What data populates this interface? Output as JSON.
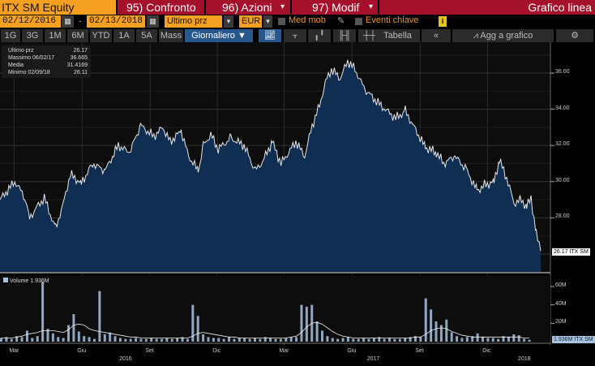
{
  "header": {
    "ticker": "ITX SM Equity",
    "compare": "95) Confronto",
    "actions": "96) Azioni",
    "modify": "97) Modif",
    "chart_type": "Grafico linea"
  },
  "controls": {
    "start_date": "02/12/2016",
    "dash": "-",
    "end_date": "02/13/2018",
    "field": "Ultimo prz",
    "currency": "EUR",
    "moving_avg": "Med mob",
    "key_events": "Eventi chiave",
    "info": "i"
  },
  "toolbar": {
    "periods": [
      "1G",
      "3G",
      "1M",
      "6M",
      "YTD",
      "1A",
      "5A",
      "Mass"
    ],
    "frequency": "Giornaliero ▼",
    "table": "Tabella",
    "collapse": "«",
    "add_to_chart": "Agg a grafico",
    "settings": "⚙"
  },
  "legend": [
    {
      "label": "Ultimo prz",
      "value": "26.17"
    },
    {
      "label": "Massimo 06/02/17",
      "value": "36.665"
    },
    {
      "label": "Media",
      "value": "31.4169"
    },
    {
      "label": "Minimo 02/09/18",
      "value": "26.11"
    }
  ],
  "volume_legend": "Volume 1.936M",
  "last_price_tag": "26.17 ITX SM",
  "last_volume_tag": "1.936M ITX SM",
  "colors": {
    "orange": "#f5a020",
    "red": "#a5102a",
    "area": "#0f2e52",
    "line": "#e6e6e6",
    "volume": "#a7c3e0"
  },
  "chart_data": [
    {
      "type": "area",
      "title": "ITX SM Equity - Ultimo prz",
      "x_unit": "days since 02/12/2016",
      "ylim": [
        25.5,
        37.5
      ],
      "yticks": [
        "36.00",
        "34.00",
        "32.00",
        "30.00",
        "28.00"
      ],
      "xticks": [
        {
          "label": "Mar",
          "day": 19
        },
        {
          "label": "Giu",
          "day": 111
        },
        {
          "label": "Set",
          "day": 203
        },
        {
          "label": "Dic",
          "day": 294
        },
        {
          "label": "Mar",
          "day": 384
        },
        {
          "label": "Giu",
          "day": 476
        },
        {
          "label": "Set",
          "day": 568
        },
        {
          "label": "Dic",
          "day": 659
        }
      ],
      "years": [
        {
          "label": "2016",
          "day": 170
        },
        {
          "label": "2017",
          "day": 505
        },
        {
          "label": "2018",
          "day": 709
        }
      ],
      "x": [
        0,
        8,
        20,
        33,
        40,
        50,
        60,
        75,
        85,
        95,
        110,
        125,
        142,
        160,
        175,
        190,
        208,
        220,
        230,
        245,
        255,
        268,
        275,
        285,
        295,
        312,
        330,
        345,
        355,
        368,
        380,
        390,
        400,
        412,
        422,
        432,
        440,
        448,
        460,
        470,
        480,
        493,
        515,
        535,
        548,
        560,
        575,
        590,
        600,
        615,
        630,
        645,
        655,
        668,
        675,
        685,
        695,
        705,
        712,
        718,
        725,
        731
      ],
      "y": [
        29.0,
        29.4,
        30.0,
        29.2,
        28.0,
        28.6,
        29.1,
        27.4,
        28.7,
        30.4,
        29.9,
        31.0,
        30.6,
        32.0,
        31.6,
        33.1,
        32.5,
        33.0,
        32.2,
        32.8,
        31.4,
        30.6,
        32.0,
        32.6,
        31.8,
        32.4,
        32.0,
        30.6,
        31.1,
        32.2,
        31.0,
        31.6,
        32.2,
        31.4,
        33.1,
        34.2,
        35.5,
        36.2,
        35.7,
        36.665,
        36.2,
        35.1,
        34.2,
        33.5,
        33.9,
        33.0,
        31.9,
        31.6,
        31.0,
        31.4,
        30.7,
        29.5,
        29.8,
        30.0,
        31.2,
        30.2,
        28.8,
        29.0,
        28.6,
        29.1,
        27.1,
        26.17
      ]
    },
    {
      "type": "bar",
      "title": "Volume",
      "ylim": [
        0,
        75
      ],
      "yticks": [
        "60M",
        "40M",
        "20M"
      ],
      "unit": "M",
      "x_step_days": 7,
      "values": [
        4,
        5,
        3,
        6,
        5,
        12,
        4,
        6,
        65,
        14,
        9,
        5,
        4,
        18,
        30,
        11,
        6,
        5,
        3,
        55,
        8,
        10,
        6,
        4,
        3,
        3,
        4,
        3,
        3,
        4,
        3,
        3,
        4,
        3,
        4,
        5,
        3,
        40,
        28,
        8,
        5,
        4,
        4,
        3,
        5,
        3,
        4,
        4,
        3,
        4,
        3,
        5,
        4,
        3,
        3,
        4,
        5,
        5,
        40,
        38,
        40,
        22,
        12,
        6,
        4,
        3,
        4,
        5,
        3,
        3,
        4,
        3,
        4,
        5,
        3,
        4,
        3,
        3,
        4,
        5,
        6,
        5,
        47,
        35,
        22,
        18,
        24,
        10,
        6,
        4,
        5,
        6,
        9,
        5,
        4,
        4,
        3,
        6,
        5,
        8,
        7,
        3,
        2
      ],
      "moving_avg": [
        4,
        4,
        4,
        5,
        6,
        8,
        9,
        10,
        12,
        12,
        12,
        11,
        10,
        13,
        18,
        19,
        18,
        14,
        12,
        11,
        10,
        9,
        8,
        7,
        6,
        5,
        5,
        4,
        4,
        4,
        4,
        4,
        4,
        4,
        4,
        4,
        4,
        6,
        9,
        10,
        9,
        8,
        7,
        6,
        5,
        5,
        4,
        4,
        4,
        4,
        4,
        4,
        4,
        4,
        4,
        4,
        5,
        6,
        10,
        16,
        20,
        21,
        19,
        15,
        11,
        8,
        6,
        5,
        4,
        4,
        4,
        4,
        4,
        4,
        4,
        4,
        4,
        4,
        4,
        4,
        5,
        5,
        8,
        12,
        14,
        15,
        14,
        11,
        9,
        7,
        6,
        5,
        5,
        5,
        5,
        5,
        5,
        5,
        5,
        5,
        5,
        4,
        4
      ]
    }
  ]
}
